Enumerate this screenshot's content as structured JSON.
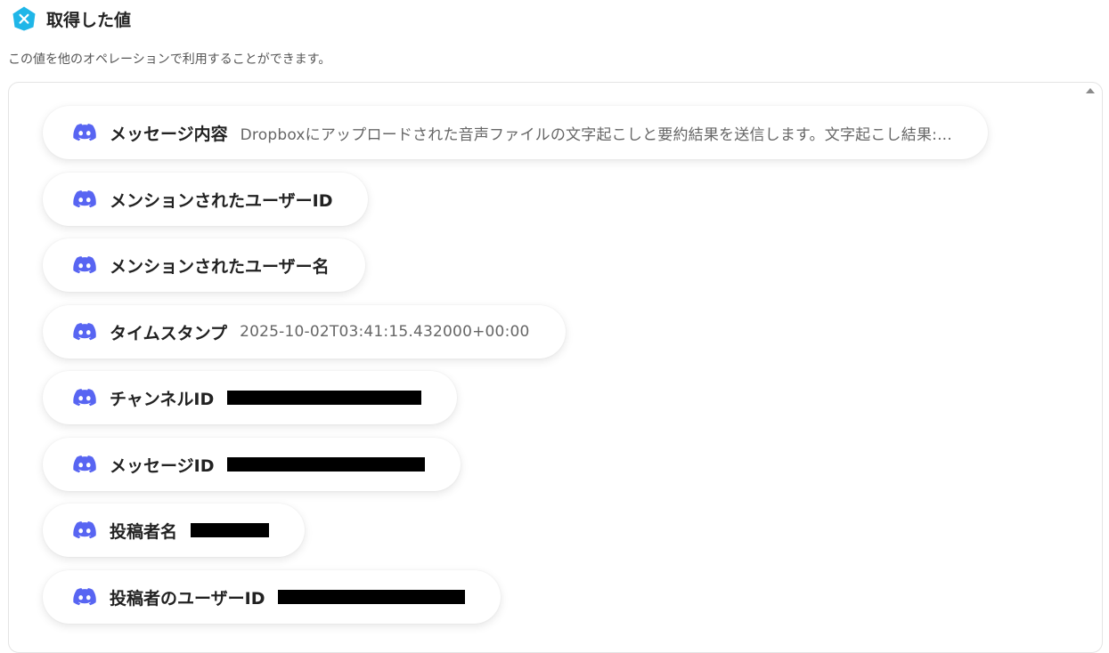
{
  "header": {
    "badge_icon": "yoom-hexagon-x-icon",
    "title": "取得した値",
    "subtitle": "この値を他のオペレーションで利用することができます。"
  },
  "colors": {
    "accent": "#1fb6e8",
    "discord": "#5865f2",
    "pill_bg": "#ffffff",
    "redaction": "#000000"
  },
  "items": [
    {
      "label": "メッセージ内容",
      "value": "Dropboxにアップロードされた音声ファイルの文字起こしと要約結果を送信します。文字起こし結果:...",
      "redacted": false,
      "icon": "discord-icon"
    },
    {
      "label": "メンションされたユーザーID",
      "value": "",
      "redacted": false,
      "icon": "discord-icon"
    },
    {
      "label": "メンションされたユーザー名",
      "value": "",
      "redacted": false,
      "icon": "discord-icon"
    },
    {
      "label": "タイムスタンプ",
      "value": "2025-10-02T03:41:15.432000+00:00",
      "redacted": false,
      "icon": "discord-icon"
    },
    {
      "label": "チャンネルID",
      "value": "",
      "redacted": true,
      "icon": "discord-icon"
    },
    {
      "label": "メッセージID",
      "value": "",
      "redacted": true,
      "icon": "discord-icon"
    },
    {
      "label": "投稿者名",
      "value": "",
      "redacted": true,
      "icon": "discord-icon"
    },
    {
      "label": "投稿者のユーザーID",
      "value": "",
      "redacted": true,
      "icon": "discord-icon"
    }
  ]
}
